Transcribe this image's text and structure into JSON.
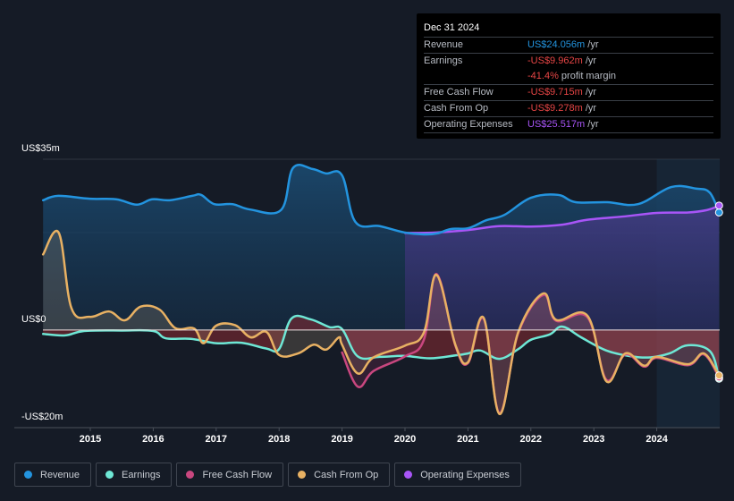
{
  "tooltip": {
    "date": "Dec 31 2024",
    "rows": [
      {
        "label": "Revenue",
        "value": "US$24.056m",
        "unit": " /yr",
        "color": "#2394df"
      },
      {
        "label": "Earnings",
        "value": "-US$9.962m",
        "unit": " /yr",
        "color": "#e64545"
      },
      {
        "label": "",
        "value": "-41.4%",
        "unit": " profit margin",
        "color": "#e64545"
      },
      {
        "label": "Free Cash Flow",
        "value": "-US$9.715m",
        "unit": " /yr",
        "color": "#e64545"
      },
      {
        "label": "Cash From Op",
        "value": "-US$9.278m",
        "unit": " /yr",
        "color": "#e64545"
      },
      {
        "label": "Operating Expenses",
        "value": "US$25.517m",
        "unit": " /yr",
        "color": "#a855f7"
      }
    ]
  },
  "legend": [
    {
      "label": "Revenue",
      "color": "#2394df"
    },
    {
      "label": "Earnings",
      "color": "#6ee7d5"
    },
    {
      "label": "Free Cash Flow",
      "color": "#c9477f"
    },
    {
      "label": "Cash From Op",
      "color": "#e8b163"
    },
    {
      "label": "Operating Expenses",
      "color": "#a855f7"
    }
  ],
  "chart_data": {
    "type": "line",
    "title": "",
    "xlabel": "",
    "ylabel": "",
    "y_unit": "US$m",
    "ylim": [
      -20,
      35
    ],
    "xlim": [
      2014.25,
      2024.99
    ],
    "y_tick_labels": [
      {
        "value": 35,
        "label": "US$35m"
      },
      {
        "value": 0,
        "label": "US$0"
      },
      {
        "value": -20,
        "label": "-US$20m"
      }
    ],
    "gridlines": [
      35,
      20,
      0,
      -20
    ],
    "x_ticks": [
      2015,
      2016,
      2017,
      2018,
      2019,
      2020,
      2021,
      2022,
      2023,
      2024
    ],
    "x_tick_labels": [
      "2015",
      "2016",
      "2017",
      "2018",
      "2019",
      "2020",
      "2021",
      "2022",
      "2023",
      "2024"
    ],
    "highlight_from": 2024.0,
    "series": [
      {
        "name": "Revenue",
        "color": "#2394df",
        "points": [
          [
            2014.25,
            26.6
          ],
          [
            2014.49,
            27.5
          ],
          [
            2014.99,
            26.9
          ],
          [
            2015.41,
            26.8
          ],
          [
            2015.74,
            25.7
          ],
          [
            2015.98,
            26.8
          ],
          [
            2016.26,
            26.6
          ],
          [
            2016.62,
            27.5
          ],
          [
            2016.76,
            27.7
          ],
          [
            2016.97,
            25.8
          ],
          [
            2017.26,
            25.8
          ],
          [
            2017.54,
            24.7
          ],
          [
            2018.03,
            24.6
          ],
          [
            2018.22,
            33.2
          ],
          [
            2018.53,
            33.0
          ],
          [
            2018.74,
            32.1
          ],
          [
            2019.0,
            31.7
          ],
          [
            2019.21,
            22.2
          ],
          [
            2019.6,
            21.3
          ],
          [
            2019.99,
            20.0
          ],
          [
            2020.3,
            19.6
          ],
          [
            2020.51,
            19.8
          ],
          [
            2020.73,
            20.7
          ],
          [
            2021.01,
            20.9
          ],
          [
            2021.29,
            22.5
          ],
          [
            2021.58,
            23.6
          ],
          [
            2022.0,
            27.1
          ],
          [
            2022.43,
            27.7
          ],
          [
            2022.71,
            26.2
          ],
          [
            2023.21,
            26.2
          ],
          [
            2023.7,
            25.8
          ],
          [
            2024.23,
            29.3
          ],
          [
            2024.62,
            29.0
          ],
          [
            2024.84,
            28.2
          ],
          [
            2024.99,
            24.1
          ]
        ]
      },
      {
        "name": "Operating Expenses",
        "color": "#a855f7",
        "points": [
          [
            2020.0,
            19.9
          ],
          [
            2020.5,
            20.0
          ],
          [
            2021.0,
            20.5
          ],
          [
            2021.5,
            21.3
          ],
          [
            2022.0,
            21.2
          ],
          [
            2022.5,
            21.6
          ],
          [
            2022.9,
            22.6
          ],
          [
            2023.5,
            23.3
          ],
          [
            2024.0,
            24.0
          ],
          [
            2024.5,
            24.1
          ],
          [
            2024.8,
            24.6
          ],
          [
            2024.99,
            25.5
          ]
        ]
      },
      {
        "name": "Earnings",
        "color": "#6ee7d5",
        "points": [
          [
            2014.25,
            -0.8
          ],
          [
            2014.6,
            -1.1
          ],
          [
            2014.9,
            -0.2
          ],
          [
            2015.5,
            -0.1
          ],
          [
            2016.0,
            -0.2
          ],
          [
            2016.2,
            -1.7
          ],
          [
            2016.6,
            -1.8
          ],
          [
            2017.0,
            -2.7
          ],
          [
            2017.4,
            -2.6
          ],
          [
            2017.8,
            -3.8
          ],
          [
            2018.0,
            -3.9
          ],
          [
            2018.2,
            2.4
          ],
          [
            2018.5,
            2.2
          ],
          [
            2018.8,
            0.6
          ],
          [
            2019.0,
            0.2
          ],
          [
            2019.25,
            -5.4
          ],
          [
            2019.6,
            -5.5
          ],
          [
            2020.0,
            -5.3
          ],
          [
            2020.4,
            -5.8
          ],
          [
            2020.8,
            -5.2
          ],
          [
            2021.0,
            -4.8
          ],
          [
            2021.2,
            -4.2
          ],
          [
            2021.5,
            -5.9
          ],
          [
            2021.8,
            -3.9
          ],
          [
            2022.0,
            -2.0
          ],
          [
            2022.3,
            -0.9
          ],
          [
            2022.5,
            0.7
          ],
          [
            2022.8,
            -1.5
          ],
          [
            2023.2,
            -4.2
          ],
          [
            2023.6,
            -5.4
          ],
          [
            2023.9,
            -5.6
          ],
          [
            2024.2,
            -4.8
          ],
          [
            2024.5,
            -3.1
          ],
          [
            2024.85,
            -4.4
          ],
          [
            2024.99,
            -9.96
          ]
        ]
      },
      {
        "name": "Free Cash Flow",
        "color": "#c9477f",
        "points": [
          [
            2019.0,
            -4.6
          ],
          [
            2019.25,
            -11.6
          ],
          [
            2019.5,
            -8.4
          ],
          [
            2020.0,
            -5.4
          ],
          [
            2020.3,
            -2.0
          ],
          [
            2020.5,
            11.5
          ],
          [
            2020.8,
            -3.2
          ],
          [
            2021.0,
            -6.8
          ],
          [
            2021.25,
            2.3
          ],
          [
            2021.5,
            -17.0
          ],
          [
            2021.8,
            -0.6
          ],
          [
            2022.2,
            7.2
          ],
          [
            2022.4,
            1.9
          ],
          [
            2022.9,
            2.6
          ],
          [
            2023.2,
            -10.2
          ],
          [
            2023.5,
            -5.0
          ],
          [
            2023.8,
            -7.5
          ],
          [
            2024.0,
            -5.7
          ],
          [
            2024.5,
            -7.2
          ],
          [
            2024.75,
            -5.0
          ],
          [
            2024.99,
            -9.7
          ]
        ]
      },
      {
        "name": "Cash From Op",
        "color": "#e8b163",
        "points": [
          [
            2014.25,
            15.5
          ],
          [
            2014.5,
            19.9
          ],
          [
            2014.7,
            4.5
          ],
          [
            2014.99,
            2.7
          ],
          [
            2015.3,
            3.8
          ],
          [
            2015.55,
            2.0
          ],
          [
            2015.8,
            4.8
          ],
          [
            2016.1,
            4.2
          ],
          [
            2016.35,
            0.4
          ],
          [
            2016.65,
            0.3
          ],
          [
            2016.8,
            -2.7
          ],
          [
            2017.0,
            0.9
          ],
          [
            2017.3,
            1.0
          ],
          [
            2017.55,
            -1.5
          ],
          [
            2017.8,
            -0.4
          ],
          [
            2018.0,
            -5.1
          ],
          [
            2018.3,
            -4.8
          ],
          [
            2018.55,
            -3.0
          ],
          [
            2018.75,
            -4.0
          ],
          [
            2018.95,
            -1.5
          ],
          [
            2019.0,
            -3.0
          ],
          [
            2019.25,
            -8.9
          ],
          [
            2019.5,
            -5.6
          ],
          [
            2020.0,
            -3.2
          ],
          [
            2020.3,
            -0.5
          ],
          [
            2020.5,
            11.3
          ],
          [
            2020.8,
            -3.0
          ],
          [
            2021.0,
            -6.6
          ],
          [
            2021.25,
            2.5
          ],
          [
            2021.5,
            -17.2
          ],
          [
            2021.8,
            -0.4
          ],
          [
            2022.2,
            7.5
          ],
          [
            2022.4,
            2.1
          ],
          [
            2022.9,
            2.9
          ],
          [
            2023.2,
            -10.5
          ],
          [
            2023.5,
            -4.8
          ],
          [
            2023.8,
            -7.3
          ],
          [
            2024.0,
            -5.5
          ],
          [
            2024.5,
            -7.0
          ],
          [
            2024.75,
            -4.8
          ],
          [
            2024.99,
            -9.3
          ]
        ]
      }
    ]
  }
}
